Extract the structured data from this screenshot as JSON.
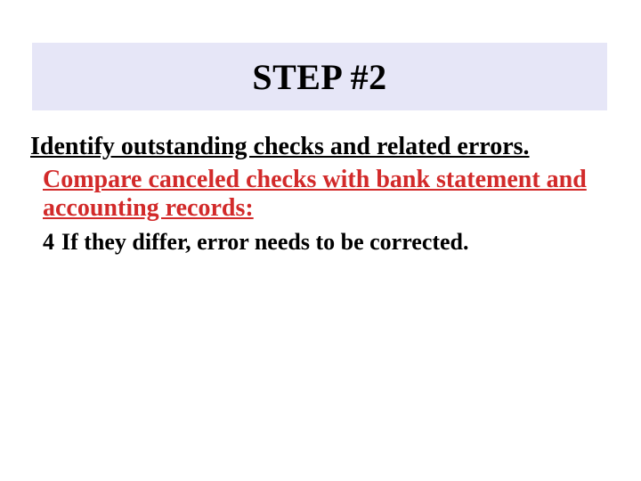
{
  "title": "STEP #2",
  "heading": "Identify outstanding checks and related errors.",
  "subheading": "Compare canceled checks with bank statement and accounting records:",
  "bullet_glyph": "4",
  "bullet_text": "If they differ, error needs to be corrected."
}
